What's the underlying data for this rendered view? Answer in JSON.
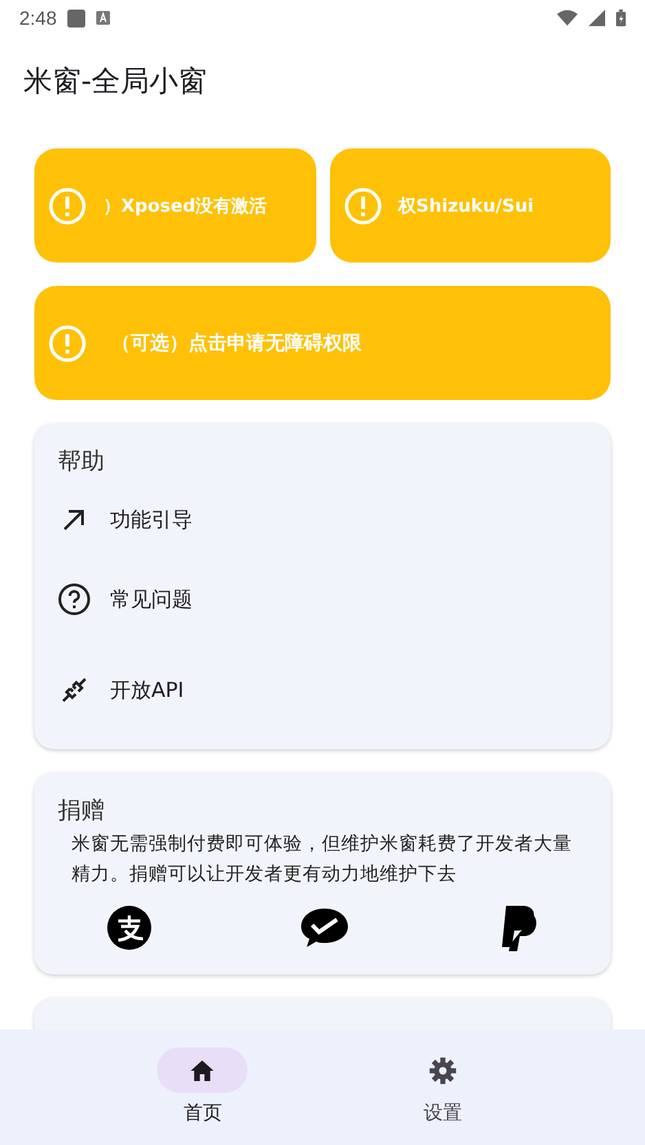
{
  "status_bar": {
    "time": "2:48"
  },
  "app_bar": {
    "title": "米窗-全局小窗"
  },
  "warnings": [
    {
      "text": "）Xposed没有激活"
    },
    {
      "text": "权Shizuku/Sui"
    },
    {
      "text": "（可选）点击申请无障碍权限"
    }
  ],
  "help": {
    "title": "帮助",
    "items": [
      {
        "kind": "guide",
        "label": "功能引导"
      },
      {
        "kind": "faq",
        "label": "常见问题"
      },
      {
        "kind": "api",
        "label": "开放API"
      }
    ]
  },
  "donate": {
    "title": "捐赠",
    "text": "米窗无需强制付费即可体验，但维护米窗耗费了开发者大量精力。捐赠可以让开发者更有动力地维护下去",
    "methods": [
      {
        "kind": "alipay"
      },
      {
        "kind": "wechat"
      },
      {
        "kind": "paypal"
      }
    ]
  },
  "nav": [
    {
      "kind": "home",
      "label": "首页",
      "selected": true
    },
    {
      "kind": "settings",
      "label": "设置",
      "selected": false
    }
  ]
}
